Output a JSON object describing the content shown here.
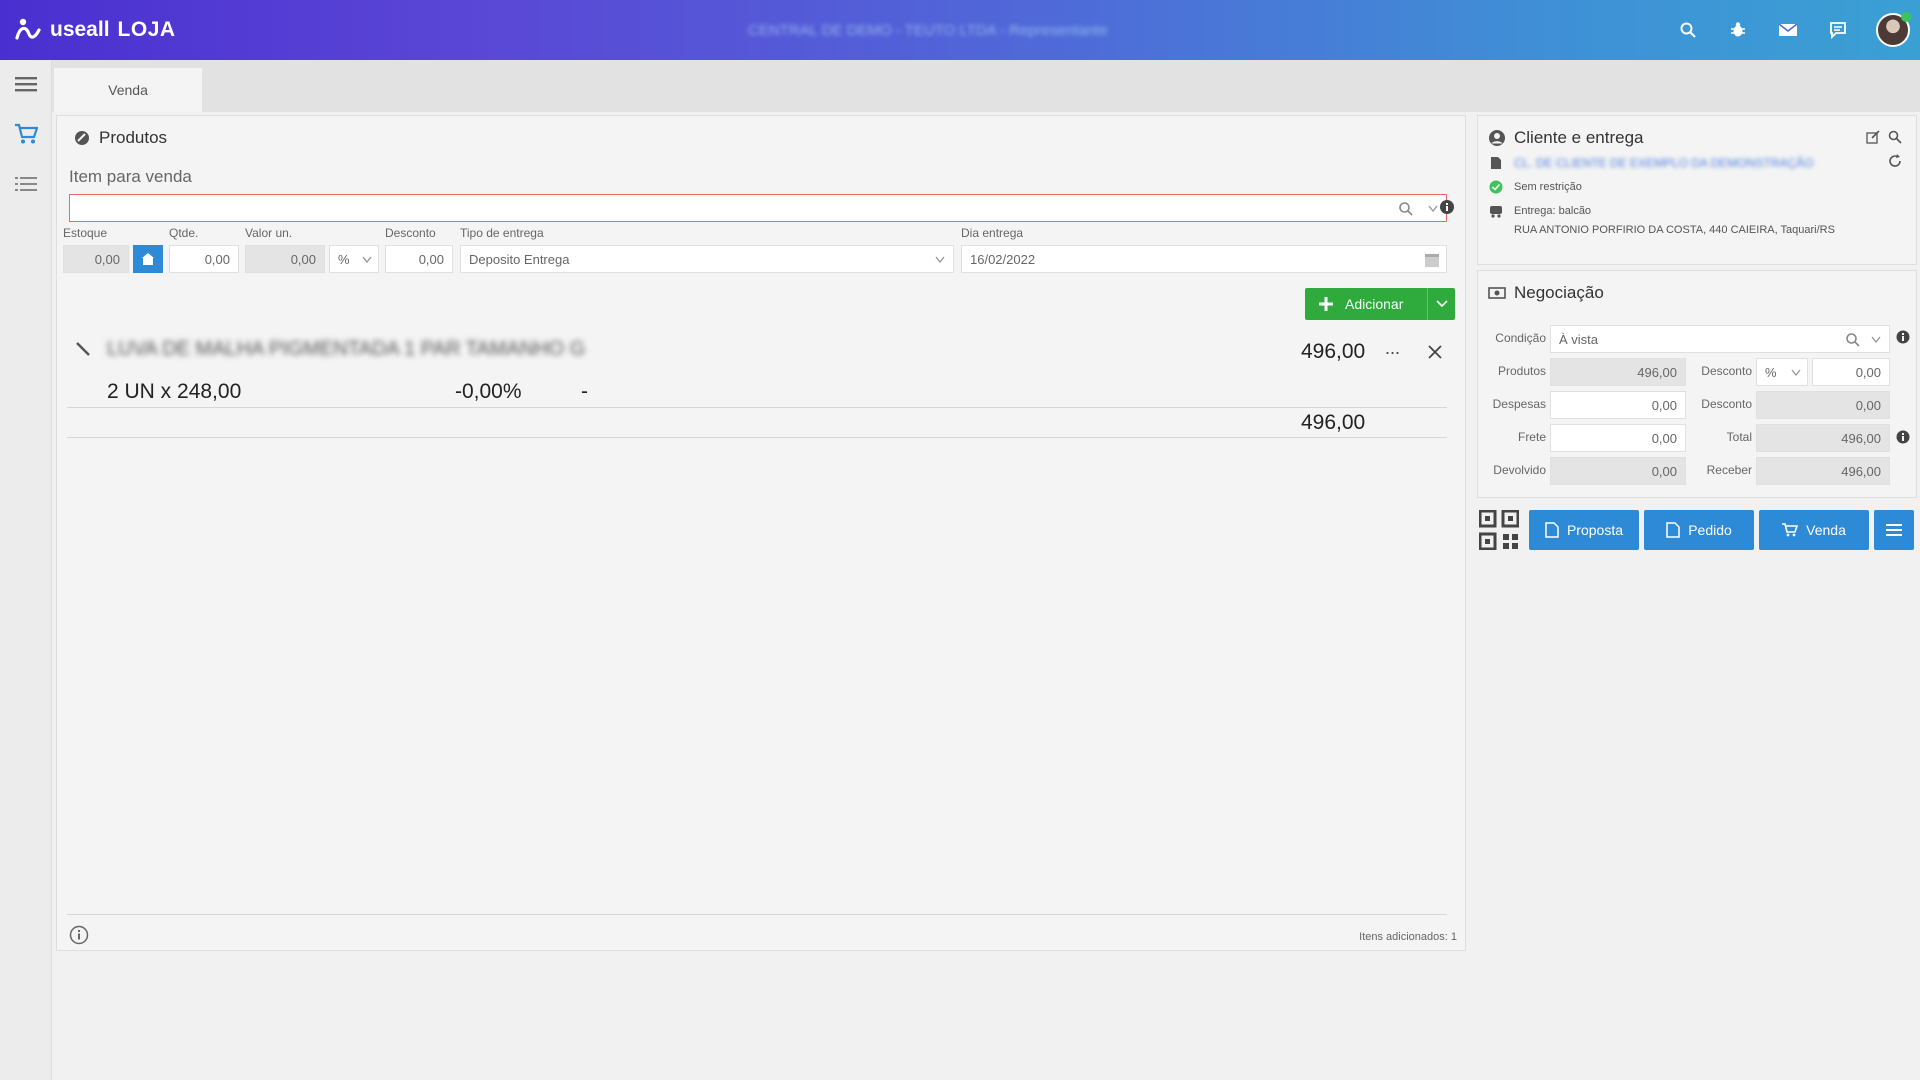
{
  "app": {
    "brand": "useall",
    "module": "LOJA",
    "company": "CENTRAL DE DEMO - TEUTO LTDA - Representante"
  },
  "tabs": [
    {
      "label": "Venda"
    }
  ],
  "products": {
    "title": "Produtos",
    "item_label": "Item para venda",
    "search_value": "",
    "fields": {
      "estoque_label": "Estoque",
      "estoque": "0,00",
      "qtde_label": "Qtde.",
      "qtde": "0,00",
      "valor_label": "Valor un.",
      "valor": "0,00",
      "desconto_type": "%",
      "desconto_label": "Desconto",
      "desconto": "0,00",
      "entrega_label": "Tipo de entrega",
      "entrega": "Deposito Entrega",
      "dia_label": "Dia entrega",
      "dia": "16/02/2022"
    },
    "add_button": "Adicionar",
    "item": {
      "name": "LUVA DE MALHA PIGMENTADA 1 PAR TAMANHO G",
      "total": "496,00",
      "quantity_line": "2 UN x 248,00",
      "discount": "-0,00%",
      "dash": "-",
      "more": "...",
      "subtotal": "496,00"
    },
    "footer_count": "Itens adicionados: 1"
  },
  "client": {
    "title": "Cliente e entrega",
    "customer": "CL. DE CLIENTE DE EXEMPLO DA DEMONSTRAÇÃO",
    "status": "Sem restrição",
    "delivery": "Entrega: balcão",
    "address": "RUA ANTONIO PORFIRIO DA COSTA, 440 CAIEIRA, Taquari/RS"
  },
  "negotiation": {
    "title": "Negociação",
    "condicao_label": "Condição",
    "condicao": "À vista",
    "produtos_label": "Produtos",
    "produtos": "496,00",
    "desconto1_label": "Desconto",
    "desconto_type": "%",
    "desconto1": "0,00",
    "despesas_label": "Despesas",
    "despesas": "0,00",
    "desconto2_label": "Desconto",
    "desconto2": "0,00",
    "frete_label": "Frete",
    "frete": "0,00",
    "total_label": "Total",
    "total": "496,00",
    "devolvido_label": "Devolvido",
    "devolvido": "0,00",
    "receber_label": "Receber",
    "receber": "496,00"
  },
  "actions": {
    "proposta": "Proposta",
    "pedido": "Pedido",
    "venda": "Venda"
  },
  "colors": {
    "accent_blue": "#2d8ad7",
    "add_green": "#2fab3d",
    "status_green": "#3cc35c"
  }
}
